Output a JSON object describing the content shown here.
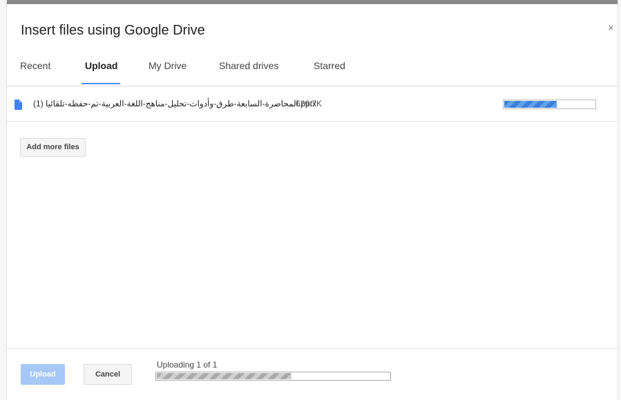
{
  "dialog": {
    "title": "Insert files using Google Drive",
    "close_icon": "close-icon",
    "close_glyph": "×"
  },
  "tabs": [
    {
      "label": "Recent",
      "active": false
    },
    {
      "label": "Upload",
      "active": true
    },
    {
      "label": "My Drive",
      "active": false
    },
    {
      "label": "Shared drives",
      "active": false
    },
    {
      "label": "Starred",
      "active": false
    }
  ],
  "files": [
    {
      "icon": "document-icon",
      "name": "المحاضرة-السابعة-طرق-وأدوات-تحليل-مناهج-اللغة-العربية-تم-حفظه-تلقائيا (1).pptx",
      "size": "629.7K",
      "progress": 0.58
    }
  ],
  "actions": {
    "add_more_label": "Add more files",
    "upload_label": "Upload",
    "cancel_label": "Cancel"
  },
  "status": {
    "text": "Uploading 1 of 1",
    "progress": 0.58
  },
  "colors": {
    "accent": "#4d90fe",
    "file_icon": "#4285f4",
    "upload_button_disabled": "#a6c8f7"
  }
}
